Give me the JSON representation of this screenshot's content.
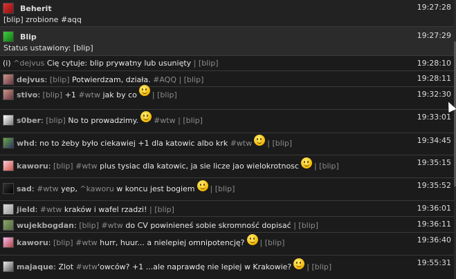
{
  "rows": [
    {
      "kind": "block",
      "name": "Beherit",
      "icon": "red-user-icon",
      "time": "19:27:28",
      "body": "[blip] zrobione #aqq"
    },
    {
      "kind": "block",
      "name": "Blip",
      "icon": "green-user-icon",
      "time": "19:27:29",
      "body": "Status ustawiony: [blip]"
    },
    {
      "kind": "line",
      "time": "19:28:10",
      "prefix": "(i)",
      "nick": "^dejvus",
      "msg": "Cię cytuje: blip prywatny lub usunięty",
      "sep": "|",
      "tag": "[blip]"
    },
    {
      "kind": "line",
      "time": "19:28:11",
      "nick": "dejvus",
      "colon": ":",
      "tag1": "[blip]",
      "msg": "Potwierdzam, działa.",
      "hash": "#AQQ",
      "sep": "|",
      "tag": "[blip]"
    },
    {
      "kind": "line",
      "time": "19:32:30",
      "nick": "stivo",
      "colon": ":",
      "tag1": "[blip]",
      "msg1": "+1",
      "hash": "#wtw",
      "msg": "jak by co",
      "sep": "|",
      "tag": "[blip]"
    },
    {
      "kind": "line",
      "time": "19:33:01",
      "nick": "s0ber",
      "colon": ":",
      "tag1": "[blip]",
      "msg": "No to prowadzimy.",
      "hash": "#wtw",
      "sep": "|",
      "tag": "[blip]"
    },
    {
      "kind": "line",
      "time": "19:34:45",
      "nick": "whd",
      "colon": ":",
      "msg": "no to żeby było ciekawiej +1 dla katowic albo krk",
      "hash": "#wtw",
      "sep": "|",
      "tag": "[blip]"
    },
    {
      "kind": "line",
      "time": "19:35:15",
      "nick": "kaworu",
      "colon": ":",
      "tag1": "[blip]",
      "hash": "#wtw",
      "msg": "plus tysiac dla katowic, ja sie licze jao wielokrotnosc",
      "sep": "|",
      "tag": "[blip]"
    },
    {
      "kind": "line",
      "time": "19:35:52",
      "nick": "sad",
      "colon": ":",
      "hash": "#wtw",
      "msg1": "yep,",
      "mention": "^kaworu",
      "msg": "w koncu jest bogiem",
      "sep": "|",
      "tag": "[blip]"
    },
    {
      "kind": "line",
      "time": "19:36:01",
      "nick": "jield",
      "colon": ":",
      "hash": "#wtw",
      "msg": "kraków i wafel rzadzi!",
      "sep": "|",
      "tag": "[blip]"
    },
    {
      "kind": "line",
      "time": "19:36:11",
      "nick": "wujekbogdan",
      "colon": ":",
      "tag1": "[blip]",
      "hash": "#wtw",
      "msg": "do CV powinieneś sobie skromność dopisać",
      "sep": "|",
      "tag": "[blip]"
    },
    {
      "kind": "line",
      "time": "19:36:40",
      "nick": "kaworu",
      "colon": ":",
      "tag1": "[blip]",
      "hash": "#wtw",
      "msg": "hurr, huur... a nielepiej omnipotencję?",
      "sep": "|",
      "tag": "[blip]"
    },
    {
      "kind": "line",
      "time": "19:55:31",
      "nick": "majaque",
      "colon": ":",
      "msg1": "Zlot",
      "hash": "#wtw",
      "msg2": "'owców? +1 ...ale naprawdę nie lepiej w Krakowie?",
      "sep": "|",
      "tag": "[blip]"
    }
  ]
}
